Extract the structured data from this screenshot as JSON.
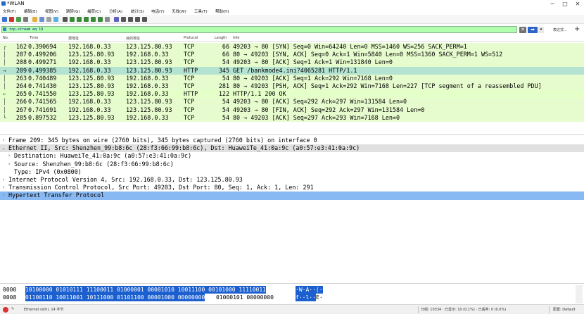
{
  "window": {
    "title": "*WLAN",
    "minimize": "─",
    "maximize": "□",
    "close": "✕"
  },
  "menu": [
    "文件(F)",
    "编辑(E)",
    "视图(V)",
    "跳转(G)",
    "捕获(C)",
    "分析(A)",
    "统计(S)",
    "电话(Y)",
    "无线(W)",
    "工具(T)",
    "帮助(H)"
  ],
  "filter": {
    "value": "tcp.stream eq 19",
    "clear": "✕",
    "apply": "➡",
    "dropdown": "▾",
    "expression": "表达式…",
    "add": "+"
  },
  "columns": [
    "No.",
    "Time",
    "源地址",
    "目的地址",
    "Protocol",
    "Length",
    "Info"
  ],
  "packets": [
    {
      "no": "162",
      "time": "0.390694",
      "src": "192.168.0.33",
      "dst": "123.125.80.93",
      "proto": "TCP",
      "len": "66",
      "info": "49203 → 80 [SYN] Seq=0 Win=64240 Len=0 MSS=1460 WS=256 SACK_PERM=1",
      "rel": "┌"
    },
    {
      "no": "207",
      "time": "0.499206",
      "src": "123.125.80.93",
      "dst": "192.168.0.33",
      "proto": "TCP",
      "len": "66",
      "info": "80 → 49203 [SYN, ACK] Seq=0 Ack=1 Win=5840 Len=0 MSS=1360 SACK_PERM=1 WS=512",
      "rel": "│"
    },
    {
      "no": "208",
      "time": "0.499271",
      "src": "192.168.0.33",
      "dst": "123.125.80.93",
      "proto": "TCP",
      "len": "54",
      "info": "49203 → 80 [ACK] Seq=1 Ack=1 Win=131840 Len=0",
      "rel": "│"
    },
    {
      "no": "209",
      "time": "0.499385",
      "src": "192.168.0.33",
      "dst": "123.125.80.93",
      "proto": "HTTP",
      "len": "345",
      "info": "GET /bankmode4.ini?4065281 HTTP/1.1",
      "rel": "→"
    },
    {
      "no": "263",
      "time": "0.740489",
      "src": "123.125.80.93",
      "dst": "192.168.0.33",
      "proto": "TCP",
      "len": "54",
      "info": "80 → 49203 [ACK] Seq=1 Ack=292 Win=7168 Len=0",
      "rel": "│"
    },
    {
      "no": "264",
      "time": "0.741430",
      "src": "123.125.80.93",
      "dst": "192.168.0.33",
      "proto": "TCP",
      "len": "281",
      "info": "80 → 49203 [PSH, ACK] Seq=1 Ack=292 Win=7168 Len=227 [TCP segment of a reassembled PDU]",
      "rel": "│"
    },
    {
      "no": "265",
      "time": "0.741550",
      "src": "123.125.80.93",
      "dst": "192.168.0.33",
      "proto": "HTTP",
      "len": "122",
      "info": "HTTP/1.1 200 OK",
      "rel": "←"
    },
    {
      "no": "266",
      "time": "0.741565",
      "src": "192.168.0.33",
      "dst": "123.125.80.93",
      "proto": "TCP",
      "len": "54",
      "info": "49203 → 80 [ACK] Seq=292 Ack=297 Win=131584 Len=0",
      "rel": "│"
    },
    {
      "no": "267",
      "time": "0.741691",
      "src": "192.168.0.33",
      "dst": "123.125.80.93",
      "proto": "TCP",
      "len": "54",
      "info": "49203 → 80 [FIN, ACK] Seq=292 Ack=297 Win=131584 Len=0",
      "rel": "│"
    },
    {
      "no": "285",
      "time": "0.897532",
      "src": "123.125.80.93",
      "dst": "192.168.0.33",
      "proto": "TCP",
      "len": "54",
      "info": "80 → 49203 [ACK] Seq=297 Ack=293 Win=7168 Len=0",
      "rel": "└"
    }
  ],
  "details": [
    {
      "arrow": "›",
      "text": "Frame 209: 345 bytes on wire (2760 bits), 345 bytes captured (2760 bits) on interface 0"
    },
    {
      "arrow": "⌄",
      "text": "Ethernet II, Src: Shenzhen_99:b8:6c (28:f3:66:99:b8:6c), Dst: HuaweiTe_41:0a:9c (a0:57:e3:41:0a:9c)"
    },
    {
      "arrow": "›",
      "text": "Destination: HuaweiTe_41:0a:9c (a0:57:e3:41:0a:9c)"
    },
    {
      "arrow": "›",
      "text": "Source: Shenzhen_99:b8:6c (28:f3:66:99:b8:6c)"
    },
    {
      "arrow": "",
      "text": "Type: IPv4 (0x0800)"
    },
    {
      "arrow": "›",
      "text": "Internet Protocol Version 4, Src: 192.168.0.33, Dst: 123.125.80.93"
    },
    {
      "arrow": "›",
      "text": "Transmission Control Protocol, Src Port: 49203, Dst Port: 80, Seq: 1, Ack: 1, Len: 291"
    },
    {
      "arrow": "›",
      "text": "Hypertext Transfer Protocol"
    }
  ],
  "bytes": [
    {
      "offset": "0000",
      "bits_hl": "10100000 01010111 11100011 01000001 00001010 10011100 00101000 11110011",
      "bits_plain": "",
      "ascii_hl": "·W·A··(·",
      "ascii_plain": ""
    },
    {
      "offset": "0008",
      "bits_hl": "01100110 10011001 10111000 01101100 00001000 00000000",
      "bits_plain": " 01000101 00000000",
      "ascii_hl": "f··l··",
      "ascii_plain": "E·"
    }
  ],
  "status": {
    "interface": "Ethernet (eth), 14 字节",
    "packets": "分组: 10334 · 已显示: 10 (0.1%) · 已丢弃: 0 (0.0%)",
    "profile": "配置: Default"
  }
}
